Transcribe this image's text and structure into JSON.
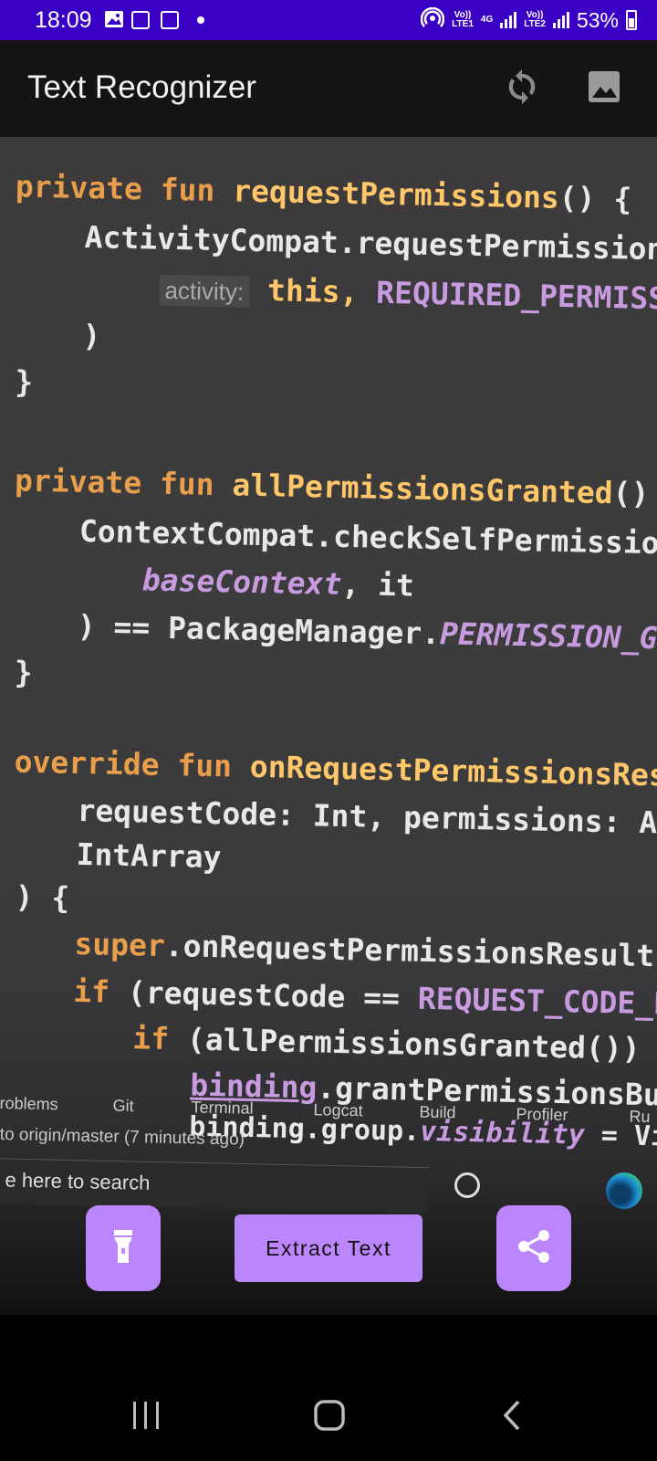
{
  "status_bar": {
    "time": "18:09",
    "sim1_top": "Vo))",
    "sim1_bottom": "LTE1",
    "network": "4G",
    "sim2_top": "Vo))",
    "sim2_bottom": "LTE2",
    "battery": "53%"
  },
  "app_bar": {
    "title": "Text Recognizer",
    "actions": [
      "refresh-icon",
      "gallery-icon"
    ]
  },
  "preview": {
    "code_lines": {
      "l1_kw": "private fun ",
      "l1_fn": "requestPermissions",
      "l1_rest": "() {",
      "l2": "ActivityCompat.requestPermissions",
      "l3_hint": "activity:",
      "l3_kw": " this, ",
      "l3_const": "REQUIRED_PERMISS",
      "l4": ")",
      "l5": "}",
      "l6_kw": "private fun ",
      "l6_fn": "allPermissionsGranted",
      "l6_rest": "() =",
      "l7": "ContextCompat.checkSelfPermission(",
      "l8_ital": "baseContext",
      "l8_rest": ", it",
      "l9_a": ") == PackageManager.",
      "l9_ital": "PERMISSION_GRAN",
      "l10": "}",
      "l11_kw": "override fun ",
      "l11_fn": "onRequestPermissionsResult",
      "l12": "requestCode: Int, permissions: Array",
      "l13": "IntArray",
      "l14": ") {",
      "l15_kw": "super",
      "l15_rest": ".onRequestPermissionsResult(requ",
      "l16_kw": "if ",
      "l16_a": "(requestCode == ",
      "l16_const": "REQUEST_CODE_PERMI",
      "l17_kw": "if ",
      "l17_rest": "(allPermissionsGranted()) {",
      "l18_a": "binding",
      "l18_rest": ".grantPermissionsButto",
      "l19_a": "binding.group.",
      "l19_ital": "visibility",
      "l19_rest": " = Vie"
    },
    "ide_tabs": [
      "roblems",
      "Git",
      "Terminal",
      "Logcat",
      "Build",
      "Profiler",
      "Ru"
    ],
    "ide_status": " to origin/master (7 minutes ago)",
    "taskbar_search": "e here to search"
  },
  "buttons": {
    "flashlight": "flashlight-icon",
    "extract_label": "Extract Text",
    "share": "share-icon"
  },
  "accent_color": "#bb86fc",
  "status_color": "#3a00c4"
}
